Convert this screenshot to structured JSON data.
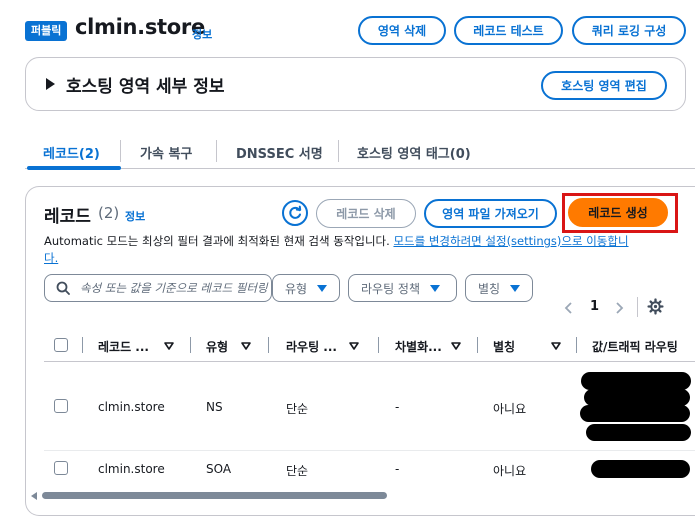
{
  "header": {
    "badge": "퍼블릭",
    "title": "clmin.store",
    "info": "정보",
    "buttons": {
      "delete_zone": "영역 삭제",
      "test_record": "레코드 테스트",
      "query_logging": "쿼리 로깅 구성"
    }
  },
  "details": {
    "title": "호스팅 영역 세부 정보",
    "edit_button": "호스팅 영역 편집"
  },
  "tabs": [
    {
      "label": "레코드(2)",
      "active": true
    },
    {
      "label": "가속 복구",
      "active": false
    },
    {
      "label": "DNSSEC 서명",
      "active": false
    },
    {
      "label": "호스팅 영역 태그(0)",
      "active": false
    }
  ],
  "records": {
    "title": "레코드",
    "count": "(2)",
    "info": "정보",
    "buttons": {
      "delete": "레코드 삭제",
      "import": "영역 파일 가져오기",
      "create": "레코드 생성"
    },
    "description": "Automatic 모드는 최상의 필터 결과에 최적화된 현재 검색 동작입니다.",
    "description_link_line1": "모드를 변경하려면 설정(settings)으로 이동합니",
    "description_link_line2": "다.",
    "search_placeholder": "속성 또는 값을 기준으로 레코드 필터링",
    "filters": {
      "type": "유형",
      "routing": "라우팅 정책",
      "alias": "별칭"
    },
    "pagination": {
      "page": "1"
    },
    "columns": [
      "레코드 ...",
      "유형",
      "라우팅 ...",
      "차별화...",
      "별칭",
      "값/트래픽 라우팅"
    ],
    "rows": [
      {
        "name": "clmin.store",
        "type": "NS",
        "routing": "단순",
        "diff": "-",
        "alias": "아니요"
      },
      {
        "name": "clmin.store",
        "type": "SOA",
        "routing": "단순",
        "diff": "-",
        "alias": "아니요"
      }
    ]
  },
  "colors": {
    "accent": "#0972d3",
    "primary": "#ff7a00",
    "highlight_box": "#d91515"
  }
}
